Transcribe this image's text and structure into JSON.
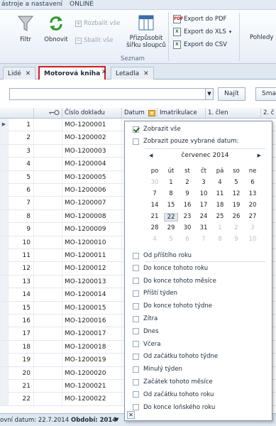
{
  "topbar": {
    "menu_left": "ástroje a nastavení",
    "menu_right": "ONLINE"
  },
  "ribbon": {
    "filter": "Filtr",
    "refresh": "Obnovit",
    "expand_all": "Rozbalit vše",
    "collapse_all": "Sbalit vše",
    "fit_columns": "Přizpůsobit\nšířku sloupců",
    "export_pdf": "Export do PDF",
    "export_xls": "Export do XLS",
    "export_csv": "Export do CSV",
    "views": "Pohledy",
    "group_label": "Seznam"
  },
  "tabs": [
    {
      "label": "Lidé"
    },
    {
      "label": "Motorová kniha"
    },
    {
      "label": "Letadla"
    }
  ],
  "search": {
    "value": "",
    "find_label": "Najít",
    "clear_label": "Smaza"
  },
  "grid": {
    "headers": {
      "doc": "Číslo dokladu",
      "date": "Datum",
      "imat": "Imatrikulace",
      "member1": "1. člen",
      "member2": "2. č"
    },
    "rows": [
      {
        "n": "1",
        "doc": "MO-1200001"
      },
      {
        "n": "2",
        "doc": "MO-1200002"
      },
      {
        "n": "3",
        "doc": "MO-1200003"
      },
      {
        "n": "4",
        "doc": "MO-1200004"
      },
      {
        "n": "5",
        "doc": "MO-1200005"
      },
      {
        "n": "6",
        "doc": "MO-1200006"
      },
      {
        "n": "7",
        "doc": "MO-1200007"
      },
      {
        "n": "8",
        "doc": "MO-1200008"
      },
      {
        "n": "9",
        "doc": "MO-1200009"
      },
      {
        "n": "10",
        "doc": "MO-1200010"
      },
      {
        "n": "11",
        "doc": "MO-1200011"
      },
      {
        "n": "12",
        "doc": "MO-1200012"
      },
      {
        "n": "13",
        "doc": "MO-1200013"
      },
      {
        "n": "14",
        "doc": "MO-1200014"
      },
      {
        "n": "15",
        "doc": "MO-1200015"
      },
      {
        "n": "16",
        "doc": "MO-1200016"
      },
      {
        "n": "17",
        "doc": "MO-1200017"
      },
      {
        "n": "18",
        "doc": "MO-1200018"
      },
      {
        "n": "19",
        "doc": "MO-1200019"
      },
      {
        "n": "20",
        "doc": "MO-1200020"
      },
      {
        "n": "21",
        "doc": "MO-1200021"
      },
      {
        "n": "22",
        "doc": "MO-1200022"
      }
    ]
  },
  "popup": {
    "show_all": "Zobrazit vše",
    "show_selected": "Zobrazit pouze vybrané datum:",
    "calendar": {
      "month": "červenec 2014",
      "weekdays": [
        "po",
        "út",
        "st",
        "čt",
        "pá",
        "so",
        "ne"
      ],
      "weeks": [
        [
          "30",
          "1",
          "2",
          "3",
          "4",
          "5",
          "6"
        ],
        [
          "7",
          "8",
          "9",
          "10",
          "11",
          "12",
          "13"
        ],
        [
          "14",
          "15",
          "16",
          "17",
          "18",
          "19",
          "20"
        ],
        [
          "21",
          "22",
          "23",
          "24",
          "25",
          "26",
          "27"
        ],
        [
          "28",
          "29",
          "30",
          "31",
          "1",
          "2",
          "3"
        ],
        [
          "4",
          "5",
          "6",
          "7",
          "8",
          "9",
          "10"
        ]
      ],
      "today": "22"
    },
    "options": [
      "Od příštího roku",
      "Do konce tohoto roku",
      "Do konce tohoto měsíce",
      "Příští týden",
      "Do konce tohoto týdne",
      "Zítra",
      "Dnes",
      "Včera",
      "Od začátku tohoto týdne",
      "Minulý týden",
      "Začátek tohoto měsíce",
      "Od začátku tohoto roku",
      "Do konce loňského roku"
    ]
  },
  "status": {
    "date": "ovní datum: 22.7.2014",
    "period": "Období: 2014"
  }
}
